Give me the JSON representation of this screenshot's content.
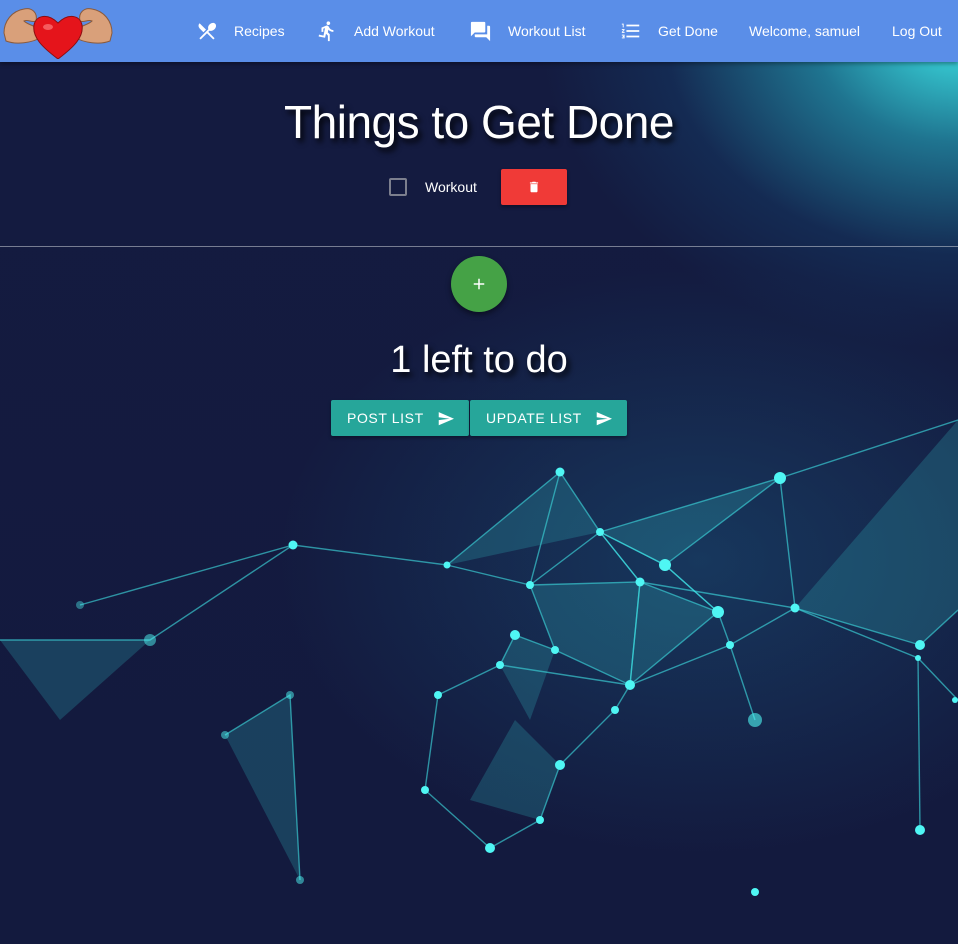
{
  "nav": {
    "items": [
      {
        "label": "Recipes",
        "icon": "fork-spoon-icon"
      },
      {
        "label": "Add Workout",
        "icon": "running-person-icon"
      },
      {
        "label": "Workout List",
        "icon": "chat-bubbles-icon"
      },
      {
        "label": "Get Done",
        "icon": "list-icon"
      }
    ],
    "welcome": "Welcome, samuel",
    "logout": "Log Out",
    "logo_icon": "muscle-heart-icon"
  },
  "page": {
    "title": "Things to Get Done",
    "remaining": "1 left to do"
  },
  "todos": [
    {
      "label": "Workout",
      "checked": false
    }
  ],
  "buttons": {
    "add_icon": "plus-icon",
    "delete_icon": "trash-icon",
    "post_list": "POST LIST",
    "update_list": "UPDATE LIST",
    "send_icon": "send-icon"
  },
  "colors": {
    "navbar": "#5a8ee8",
    "delete": "#f03a37",
    "fab": "#45a246",
    "action": "#26a69a",
    "background": "#131a3e"
  }
}
